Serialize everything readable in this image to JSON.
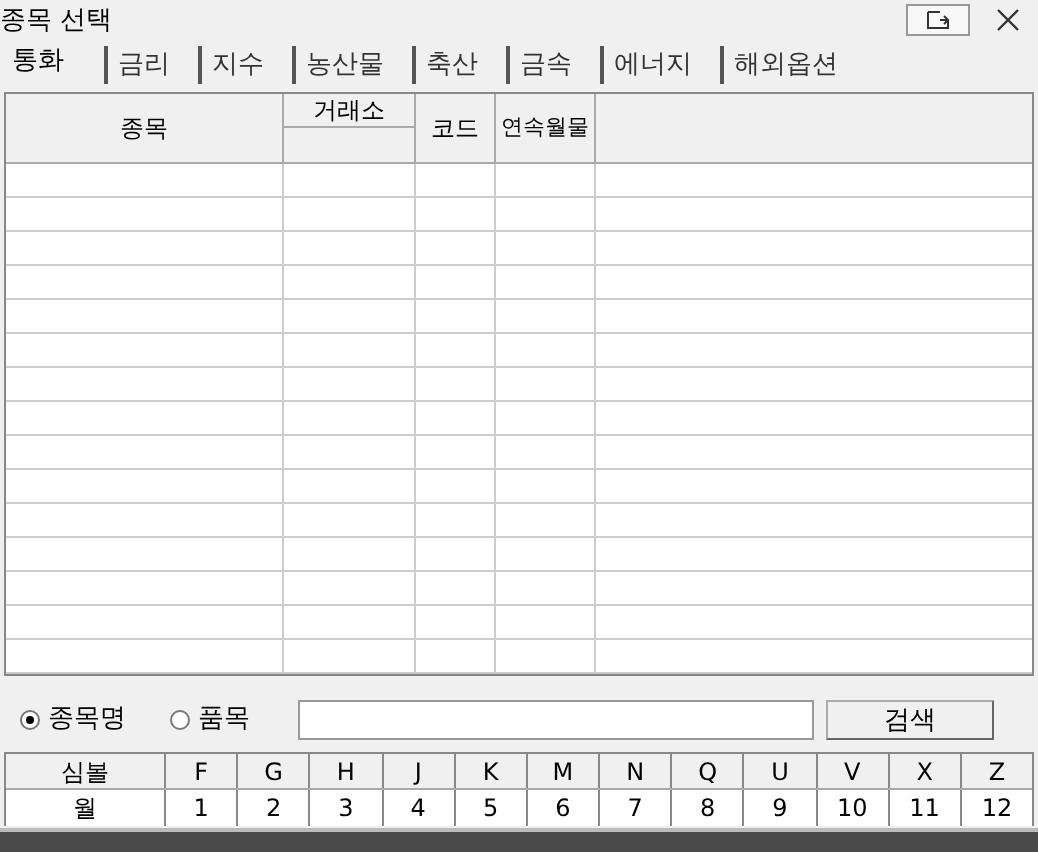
{
  "window": {
    "title": "종목 선택"
  },
  "tabs": [
    {
      "label": "통화",
      "selected": true
    },
    {
      "label": "금리",
      "selected": false
    },
    {
      "label": "지수",
      "selected": false
    },
    {
      "label": "농산물",
      "selected": false
    },
    {
      "label": "축산",
      "selected": false
    },
    {
      "label": "금속",
      "selected": false
    },
    {
      "label": "에너지",
      "selected": false
    },
    {
      "label": "해외옵션",
      "selected": false
    }
  ],
  "table": {
    "columns": [
      "종목",
      "거래소",
      "코드",
      "연속월물"
    ]
  },
  "search": {
    "options": [
      {
        "label": "종목명",
        "selected": true
      },
      {
        "label": "품목",
        "selected": false
      }
    ],
    "button": "검색"
  },
  "symbols": {
    "header": "심볼",
    "row_label": "월",
    "items": [
      {
        "symbol": "F",
        "month": "1"
      },
      {
        "symbol": "G",
        "month": "2"
      },
      {
        "symbol": "H",
        "month": "3"
      },
      {
        "symbol": "J",
        "month": "4"
      },
      {
        "symbol": "K",
        "month": "5"
      },
      {
        "symbol": "M",
        "month": "6"
      },
      {
        "symbol": "N",
        "month": "7"
      },
      {
        "symbol": "Q",
        "month": "8"
      },
      {
        "symbol": "U",
        "month": "9"
      },
      {
        "symbol": "V",
        "month": "10"
      },
      {
        "symbol": "X",
        "month": "11"
      },
      {
        "symbol": "Z",
        "month": "12"
      }
    ]
  }
}
